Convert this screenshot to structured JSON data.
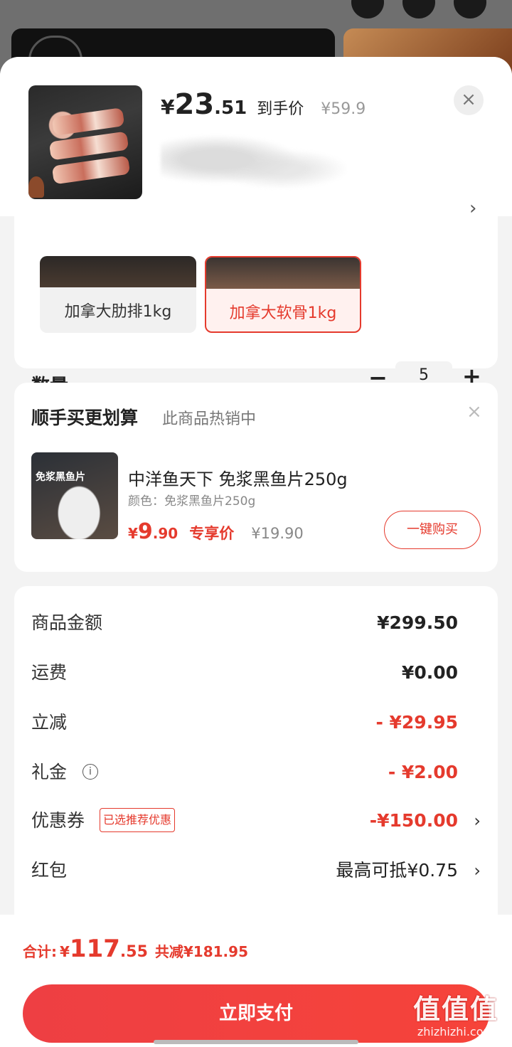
{
  "product": {
    "price_yen": "¥",
    "price_int": "23",
    "price_dec": ".51",
    "price_label": "到手价",
    "orig_price": "¥59.9",
    "close_icon": "×",
    "chevron": "›"
  },
  "variants": [
    {
      "label": "加拿大肋排1kg",
      "selected": false
    },
    {
      "label": "加拿大软骨1kg",
      "selected": true
    }
  ],
  "quantity": {
    "label": "数量",
    "minus": "−",
    "value": "5",
    "plus": "+"
  },
  "upsell": {
    "title": "顺手买更划算",
    "subtitle": "此商品热销中",
    "close_icon": "×",
    "image_tag": "免浆黑鱼片",
    "name": "中洋鱼天下 免浆黑鱼片250g",
    "color": "颜色：免浆黑鱼片250g",
    "price_yen": "¥",
    "price_int": "9",
    "price_dec": ".90",
    "price_label": "专享价",
    "orig_price": "¥19.90",
    "buy_label": "一键购买"
  },
  "summary": {
    "rows": [
      {
        "label": "商品金额",
        "value": "¥299.50"
      },
      {
        "label": "运费",
        "value": "¥0.00"
      },
      {
        "label": "立减",
        "value": "- ¥29.95"
      },
      {
        "label": "礼金",
        "value": "- ¥2.00",
        "info_icon": "i"
      },
      {
        "label": "优惠券",
        "value": "-¥150.00",
        "tag": "已选推荐优惠",
        "chevron": "›"
      },
      {
        "label": "红包",
        "value": "最高可抵¥0.75",
        "chevron": "›"
      }
    ]
  },
  "footer": {
    "total_label": "合计:",
    "total_yen": "¥",
    "total_int": "117",
    "total_dec": ".55",
    "total_save": "共减¥181.95",
    "pay_label": "立即支付"
  },
  "watermark": {
    "big": "值值值",
    "small": "zhizhizhi.com"
  },
  "colors": {
    "accent": "#e53a2d",
    "pay_button": "#f0403f"
  }
}
